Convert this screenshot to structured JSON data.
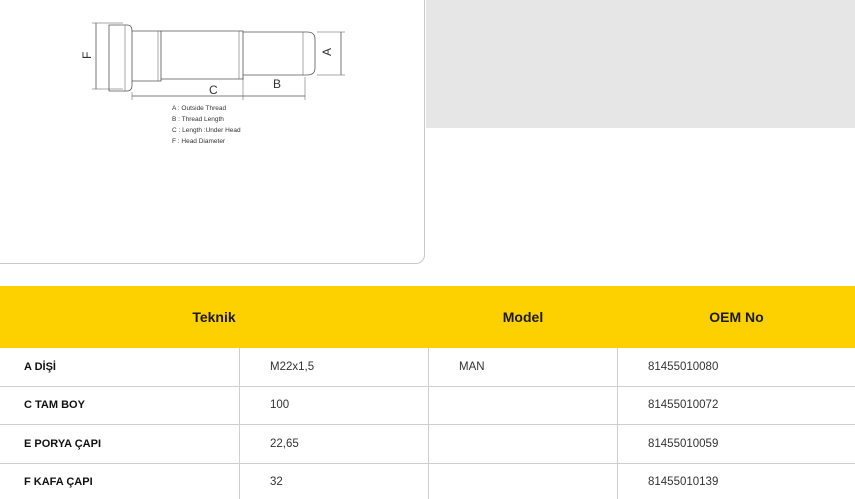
{
  "drawing": {
    "dim_labels": {
      "f": "F",
      "a": "A",
      "c": "C",
      "b": "B"
    },
    "legend": [
      "A : Outside Thread",
      "B : Thread Length",
      "C : Length :Under Head",
      "F : Head Diameter"
    ]
  },
  "table": {
    "headers": {
      "teknik": "Teknik",
      "model": "Model",
      "oem": "OEM No"
    },
    "rows": [
      {
        "label": "A DİŞİ",
        "value": "M22x1,5",
        "model": "MAN",
        "oem": "81455010080"
      },
      {
        "label": "C TAM BOY",
        "value": "100",
        "model": "",
        "oem": "81455010072"
      },
      {
        "label": "E PORYA ÇAPI",
        "value": "22,65",
        "model": "",
        "oem": "81455010059"
      },
      {
        "label": "F KAFA ÇAPI",
        "value": "32",
        "model": "",
        "oem": "81455010139"
      }
    ]
  }
}
